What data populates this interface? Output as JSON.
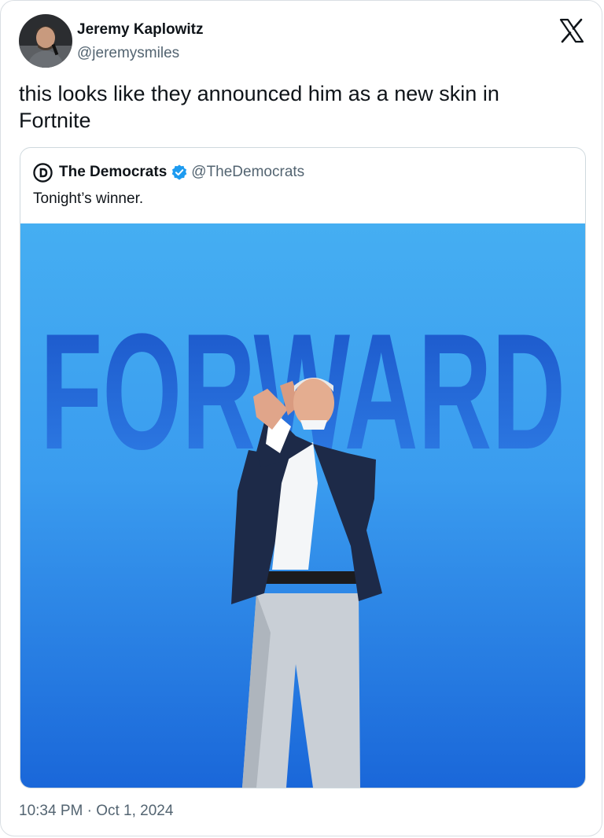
{
  "author": {
    "name": "Jeremy Kaplowitz",
    "handle": "@jeremysmiles"
  },
  "tweet": {
    "text": "this looks like they announced him as a new skin in Fortnite",
    "timestamp": "10:34 PM · Oct 1, 2024"
  },
  "quoted": {
    "name": "The Democrats",
    "handle": "@TheDemocrats",
    "text": "Tonight’s winner.",
    "verified": true,
    "image": {
      "headline": "FORWARD"
    }
  },
  "icons": {
    "platform": "x-logo-icon",
    "verified": "verified-badge-icon",
    "org_logo": "democrats-d-logo-icon"
  },
  "colors": {
    "accent": "#1d9bf0",
    "image_bg_top": "#45aef2",
    "image_bg_bottom": "#1a67d9",
    "headline": "#1c5fd0"
  }
}
